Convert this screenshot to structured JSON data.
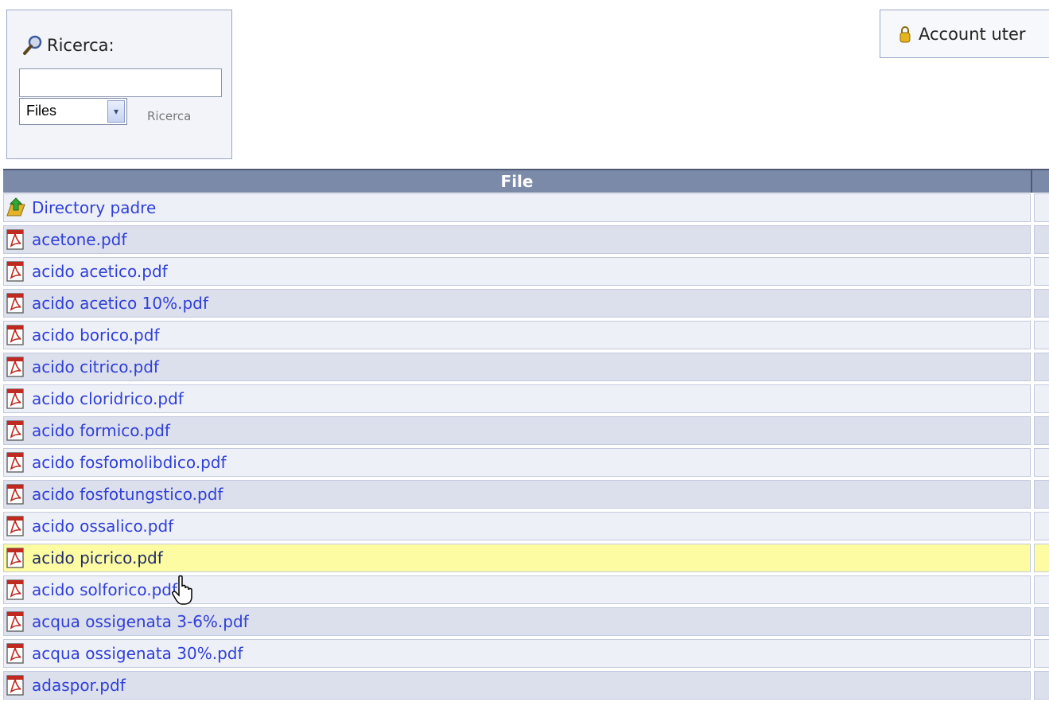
{
  "search": {
    "title": "Ricerca:",
    "input_value": "",
    "select_value": "Files",
    "button_label": "Ricerca"
  },
  "account": {
    "label": "Account uter"
  },
  "table": {
    "header": "File",
    "rows": [
      {
        "name": "Directory padre",
        "icon": "parent-folder-icon"
      },
      {
        "name": "acetone.pdf",
        "icon": "pdf-icon"
      },
      {
        "name": "acido acetico.pdf",
        "icon": "pdf-icon"
      },
      {
        "name": "acido acetico 10%.pdf",
        "icon": "pdf-icon"
      },
      {
        "name": "acido borico.pdf",
        "icon": "pdf-icon"
      },
      {
        "name": "acido citrico.pdf",
        "icon": "pdf-icon"
      },
      {
        "name": "acido cloridrico.pdf",
        "icon": "pdf-icon"
      },
      {
        "name": "acido formico.pdf",
        "icon": "pdf-icon"
      },
      {
        "name": "acido fosfomolibdico.pdf",
        "icon": "pdf-icon"
      },
      {
        "name": "acido fosfotungstico.pdf",
        "icon": "pdf-icon"
      },
      {
        "name": "acido ossalico.pdf",
        "icon": "pdf-icon"
      },
      {
        "name": "acido picrico.pdf",
        "icon": "pdf-icon",
        "highlighted": true
      },
      {
        "name": "acido solforico.pdf",
        "icon": "pdf-icon"
      },
      {
        "name": "acqua ossigenata 3-6%.pdf",
        "icon": "pdf-icon"
      },
      {
        "name": "acqua ossigenata 30%.pdf",
        "icon": "pdf-icon"
      },
      {
        "name": "adaspor.pdf",
        "icon": "pdf-icon"
      }
    ]
  },
  "colors": {
    "link": "#2f3fd8",
    "header_bg": "#7b8aa8",
    "row_odd": "#eef0f7",
    "row_even": "#dcdfec",
    "row_highlight": "#fdfca3"
  }
}
